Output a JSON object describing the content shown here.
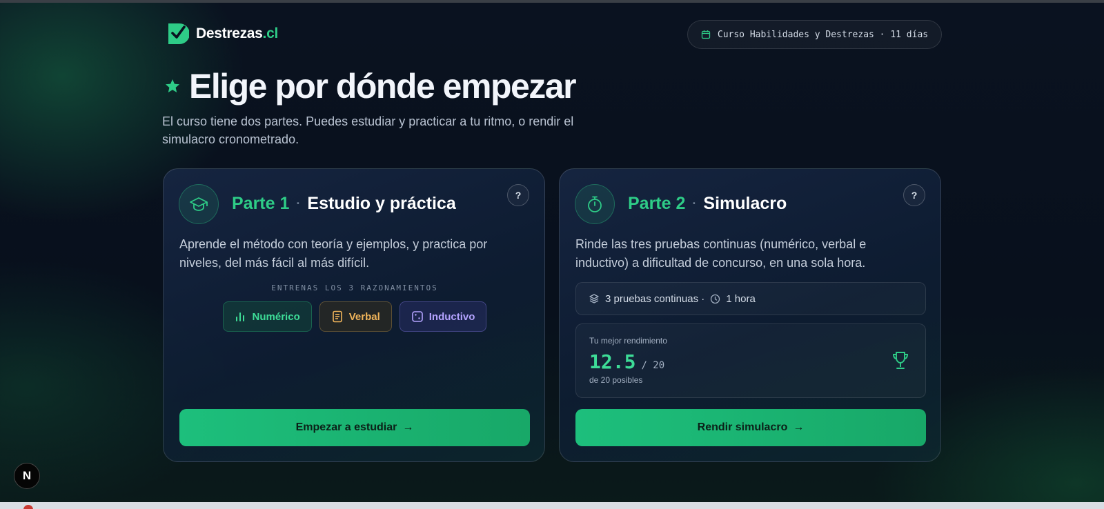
{
  "brand": {
    "name": "Destrezas",
    "tld": ".cl"
  },
  "course": {
    "label": "Curso Habilidades y Destrezas · 11 días"
  },
  "header": {
    "title": "Elige por dónde empezar",
    "subtitle": "El curso tiene dos partes. Puedes estudiar y practicar a tu ritmo, o rendir el simulacro cronometrado."
  },
  "part1": {
    "part": "Parte 1",
    "separator": "·",
    "name": "Estudio y práctica",
    "help": "?",
    "description": "Aprende el método con teoría y ejemplos, y practica por niveles, del más fácil al más difícil.",
    "train_label": "ENTRENAS LOS 3 RAZONAMIENTOS",
    "chips": [
      {
        "label": "Numérico",
        "icon": "bar-chart-icon"
      },
      {
        "label": "Verbal",
        "icon": "document-icon"
      },
      {
        "label": "Inductivo",
        "icon": "dice-icon"
      }
    ],
    "cta": "Empezar a estudiar",
    "cta_arrow": "→"
  },
  "part2": {
    "part": "Parte 2",
    "separator": "·",
    "name": "Simulacro",
    "help": "?",
    "description": "Rinde las tres pruebas continuas (numérico, verbal e inductivo) a dificultad de concurso, en una sola hora.",
    "meta": {
      "tests": "3 pruebas continuas ·",
      "duration": "1 hora"
    },
    "best": {
      "label": "Tu mejor rendimiento",
      "score": "12.5",
      "max": "/ 20",
      "sub": "de 20 posibles"
    },
    "cta": "Rendir simulacro",
    "cta_arrow": "→"
  },
  "dev_badge": {
    "letter": "N"
  },
  "colors": {
    "accent": "#2ecc87",
    "verbal": "#f0b45a",
    "inductive": "#b4a3ff",
    "background": "#08101c"
  }
}
